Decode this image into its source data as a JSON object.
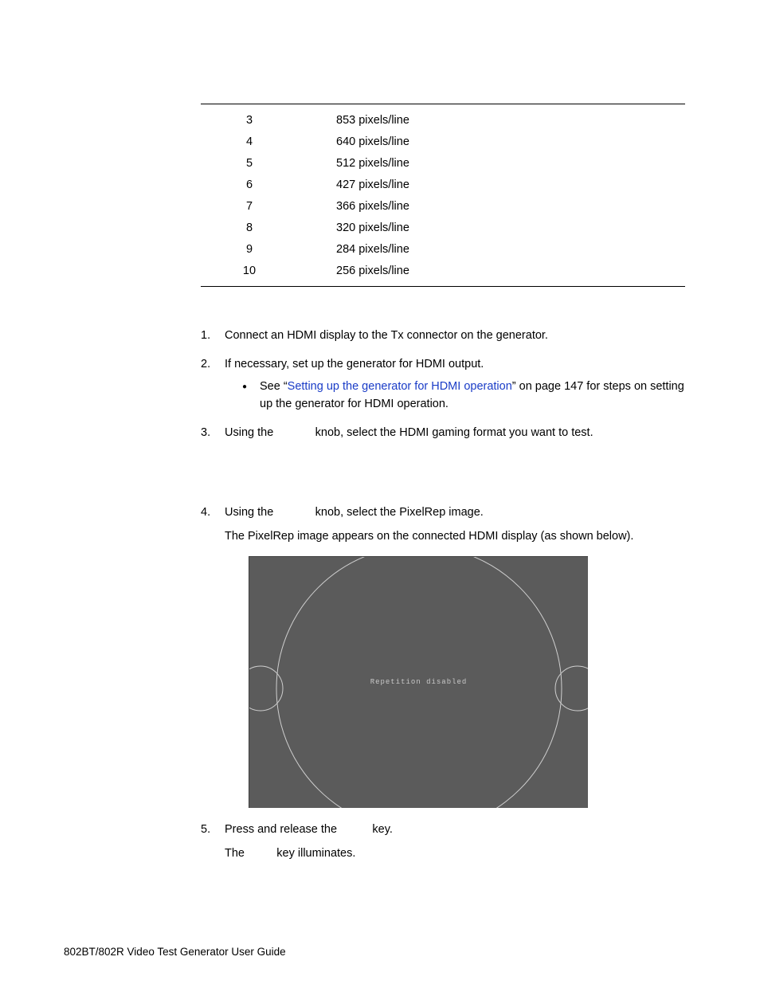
{
  "table": {
    "rows": [
      {
        "n": "3",
        "v": "853 pixels/line"
      },
      {
        "n": "4",
        "v": "640 pixels/line"
      },
      {
        "n": "5",
        "v": "512 pixels/line"
      },
      {
        "n": "6",
        "v": "427 pixels/line"
      },
      {
        "n": "7",
        "v": "366 pixels/line"
      },
      {
        "n": "8",
        "v": "320 pixels/line"
      },
      {
        "n": "9",
        "v": "284 pixels/line"
      },
      {
        "n": "10",
        "v": "256 pixels/line"
      }
    ]
  },
  "steps": {
    "s1": {
      "num": "1.",
      "text": "Connect an HDMI display to the Tx connector on the generator."
    },
    "s2": {
      "num": "2.",
      "text": "If necessary, set up the generator for HDMI output."
    },
    "s2_bullet": {
      "pre": "See “",
      "link": "Setting up the generator for HDMI operation",
      "post": "” on page 147 for steps on setting up the generator for HDMI operation."
    },
    "s3": {
      "num": "3.",
      "pre": "Using the ",
      "post": " knob, select the HDMI gaming format you want to test."
    },
    "s4": {
      "num": "4.",
      "pre": "Using the ",
      "post": " knob, select the PixelRep image."
    },
    "s4_follow": "The PixelRep image appears on the connected HDMI display (as shown below).",
    "figure_caption": "Repetition disabled",
    "s5": {
      "num": "5.",
      "pre": "Press and release the ",
      "post": " key."
    },
    "s5_follow_pre": "The ",
    "s5_follow_post": " key illuminates."
  },
  "footer": "802BT/802R Video Test Generator User Guide"
}
